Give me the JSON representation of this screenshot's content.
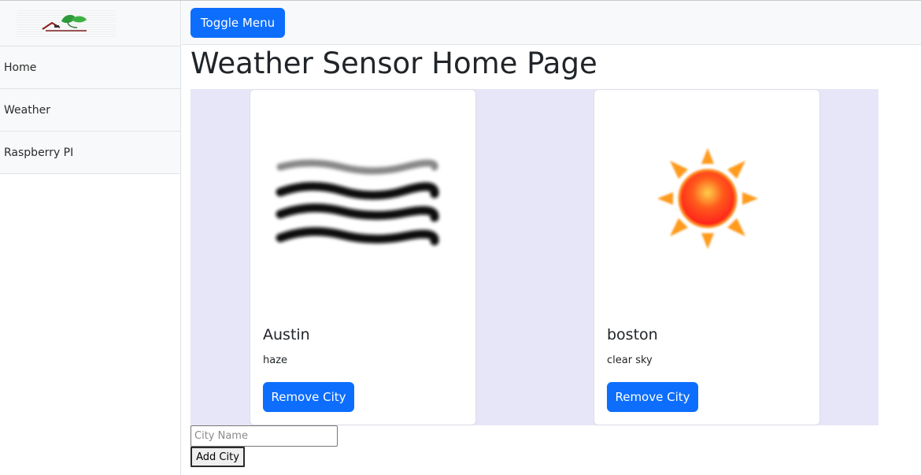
{
  "sidebar": {
    "logo_icon": "house-leaf-logo",
    "items": [
      {
        "label": "Home"
      },
      {
        "label": "Weather"
      },
      {
        "label": "Raspberry PI"
      }
    ]
  },
  "topbar": {
    "toggle_label": "Toggle Menu"
  },
  "page": {
    "title": "Weather Sensor Home Page"
  },
  "cards": [
    {
      "city": "Austin",
      "condition": "haze",
      "icon": "haze-icon",
      "button_label": "Remove City"
    },
    {
      "city": "boston",
      "condition": "clear sky",
      "icon": "sun-icon",
      "button_label": "Remove City"
    }
  ],
  "form": {
    "placeholder": "City Name",
    "value": "",
    "add_label": "Add City"
  },
  "colors": {
    "primary": "#0d6efd",
    "cards_background": "#e6e6f8",
    "sidebar_background": "#f8f9fa"
  }
}
